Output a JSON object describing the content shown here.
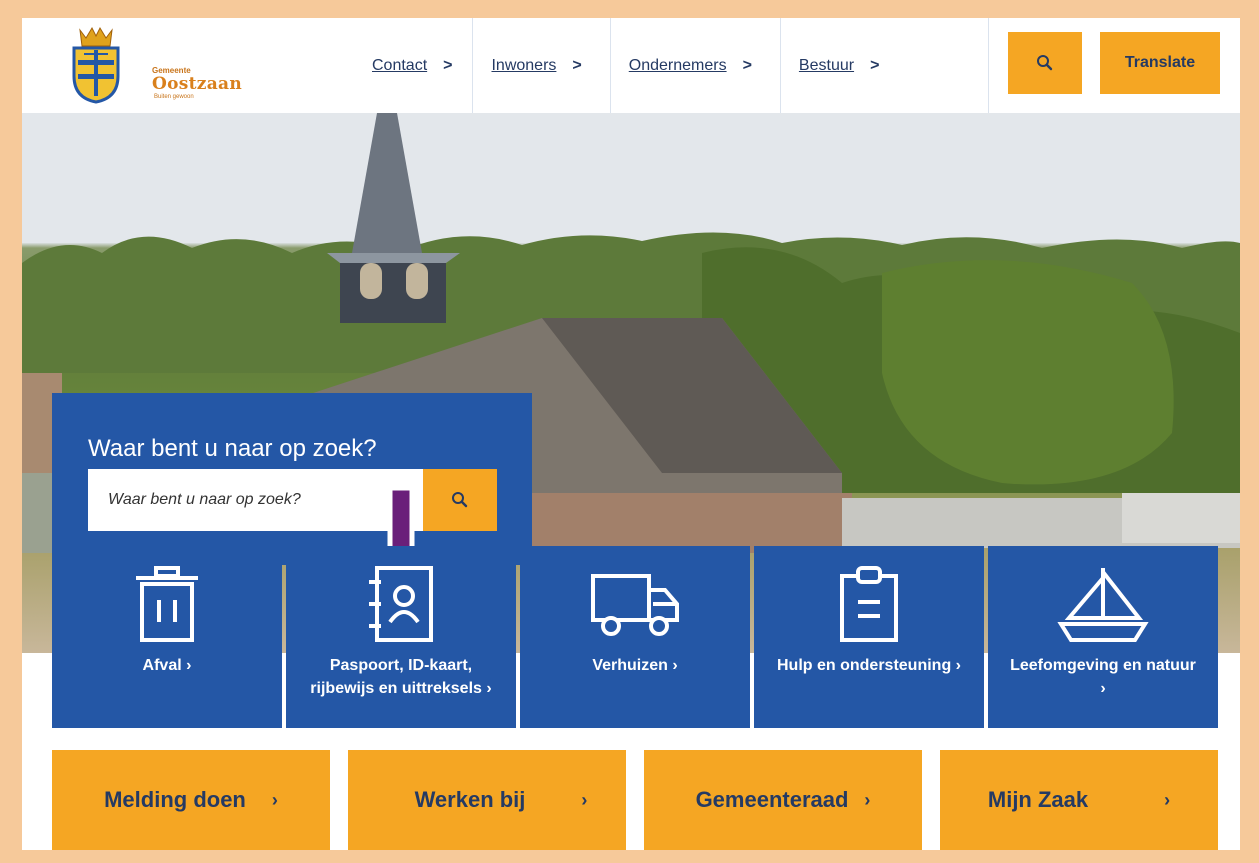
{
  "header": {
    "logo_small": "Gemeente",
    "logo_name": "Oostzaan",
    "logo_tag": "Buiten gewoon",
    "nav": [
      {
        "label": "Contact",
        "chevron": ">"
      },
      {
        "label": "Inwoners",
        "chevron": ">"
      },
      {
        "label": "Ondernemers",
        "chevron": ">"
      },
      {
        "label": "Bestuur",
        "chevron": ">"
      }
    ],
    "search_icon": "search-icon",
    "translate_label": "Translate"
  },
  "search": {
    "title": "Waar bent u naar op zoek?",
    "placeholder": "Waar bent u naar op zoek?"
  },
  "tiles": [
    {
      "label": "Afval ›",
      "icon": "trash-icon"
    },
    {
      "label": "Paspoort, ID-kaart, rijbewijs en uittreksels ›",
      "icon": "contact-book-icon"
    },
    {
      "label": "Verhuizen ›",
      "icon": "truck-icon"
    },
    {
      "label": "Hulp en ondersteuning ›",
      "icon": "clipboard-icon"
    },
    {
      "label": "Leefomgeving en natuur ›",
      "icon": "sailboat-icon"
    }
  ],
  "bottom_buttons": [
    {
      "label": "Melding doen",
      "chevron": "›"
    },
    {
      "label": "Werken bij",
      "chevron": "›"
    },
    {
      "label": "Gemeenteraad",
      "chevron": "›"
    },
    {
      "label": "Mijn Zaak",
      "chevron": "›"
    }
  ],
  "colors": {
    "primary_blue": "#2457a6",
    "accent_orange": "#f5a623",
    "nav_text": "#253a63",
    "annotation_arrow": "#6a1f7a",
    "frame": "#f6c99a"
  }
}
